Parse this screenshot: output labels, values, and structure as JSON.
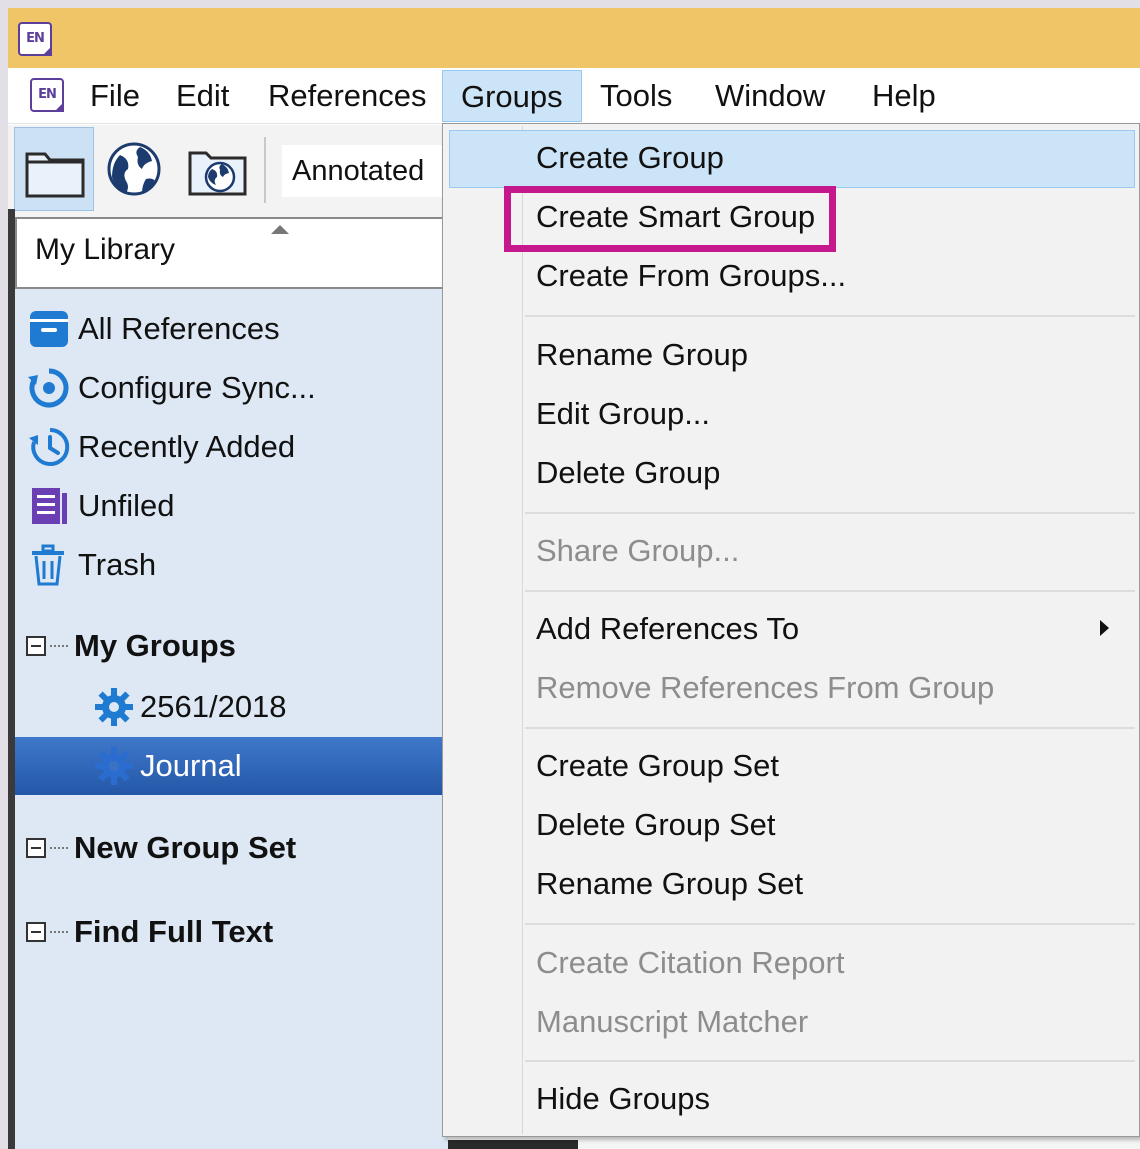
{
  "app": {
    "icon_text": "EN",
    "accent_color": "#f0c567"
  },
  "menubar": {
    "items": [
      "File",
      "Edit",
      "References",
      "Groups",
      "Tools",
      "Window",
      "Help"
    ],
    "open_menu": "Groups"
  },
  "toolbar": {
    "buttons": [
      {
        "icon": "folder-icon",
        "active": true
      },
      {
        "icon": "globe-icon",
        "active": false
      },
      {
        "icon": "library-online-icon",
        "active": false
      }
    ],
    "style_value": "Annotated"
  },
  "left_panel": {
    "library_selector": "My Library",
    "library_items": [
      {
        "label": "All References",
        "icon": "all-references-icon"
      },
      {
        "label": "Configure Sync...",
        "icon": "sync-icon"
      },
      {
        "label": "Recently Added",
        "icon": "recent-icon"
      },
      {
        "label": "Unfiled",
        "icon": "unfiled-icon"
      },
      {
        "label": "Trash",
        "icon": "trash-icon"
      }
    ],
    "group_sets": [
      {
        "label": "My Groups",
        "groups": [
          "2561/2018",
          "Journal"
        ]
      },
      {
        "label": "New Group Set",
        "groups": []
      },
      {
        "label": "Find Full Text",
        "groups": []
      }
    ],
    "selected_group": "Journal"
  },
  "groups_menu": {
    "items": [
      {
        "label": "Create Group",
        "enabled": true
      },
      {
        "label": "Create Smart Group",
        "enabled": true
      },
      {
        "label": "Create From Groups...",
        "enabled": true
      },
      {
        "label": "Rename Group",
        "enabled": true
      },
      {
        "label": "Edit Group...",
        "enabled": true
      },
      {
        "label": "Delete Group",
        "enabled": true
      },
      {
        "label": "Share Group...",
        "enabled": false
      },
      {
        "label": "Add References To",
        "enabled": true
      },
      {
        "label": "Remove References From Group",
        "enabled": false
      },
      {
        "label": "Create Group Set",
        "enabled": true
      },
      {
        "label": "Delete Group Set",
        "enabled": true
      },
      {
        "label": "Rename Group Set",
        "enabled": true
      },
      {
        "label": "Create Citation Report",
        "enabled": false
      },
      {
        "label": "Manuscript Matcher",
        "enabled": false
      },
      {
        "label": "Hide Groups",
        "enabled": true
      }
    ],
    "hovered_item": "Create Group",
    "highlighted_item": "Create Smart Group",
    "highlight_color": "#c4188c"
  }
}
